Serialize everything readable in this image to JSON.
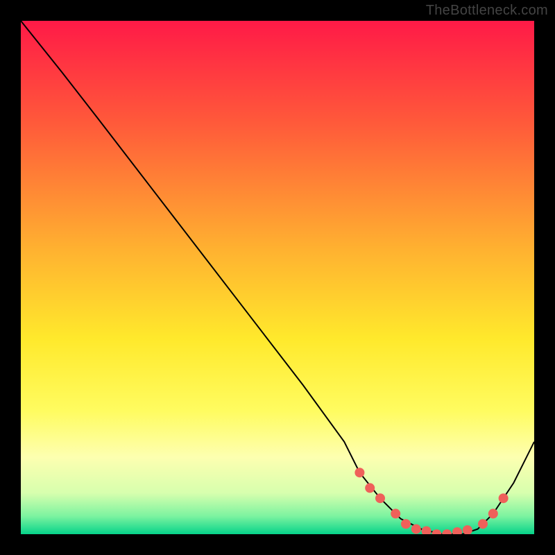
{
  "watermark": "TheBottleneck.com",
  "chart_data": {
    "type": "line",
    "title": "",
    "xlabel": "",
    "ylabel": "",
    "xlim": [
      0,
      100
    ],
    "ylim": [
      0,
      100
    ],
    "background_gradient": {
      "stops": [
        {
          "pos": 0.0,
          "color": "#ff1a47"
        },
        {
          "pos": 0.2,
          "color": "#ff5a3a"
        },
        {
          "pos": 0.45,
          "color": "#ffb330"
        },
        {
          "pos": 0.62,
          "color": "#ffe92c"
        },
        {
          "pos": 0.76,
          "color": "#fffc60"
        },
        {
          "pos": 0.85,
          "color": "#fdffb0"
        },
        {
          "pos": 0.92,
          "color": "#d7ffae"
        },
        {
          "pos": 0.965,
          "color": "#7cf3a0"
        },
        {
          "pos": 1.0,
          "color": "#06d38a"
        }
      ]
    },
    "series": [
      {
        "name": "bottleneck-curve",
        "color": "#000000",
        "x": [
          0,
          4,
          8,
          15,
          25,
          35,
          45,
          55,
          63,
          66,
          70,
          74,
          78,
          82,
          86,
          89,
          92,
          96,
          100
        ],
        "y": [
          100,
          95,
          90,
          81,
          68,
          55,
          42,
          29,
          18,
          12,
          7,
          3,
          1,
          0,
          0,
          1,
          4,
          10,
          18
        ]
      }
    ],
    "markers": {
      "name": "highlight-dots",
      "color": "#ef605a",
      "radius": 7,
      "x": [
        66,
        68,
        70,
        73,
        75,
        77,
        79,
        81,
        83,
        85,
        87,
        90,
        92,
        94
      ],
      "y": [
        12,
        9,
        7,
        4,
        2,
        1,
        0.6,
        0,
        0,
        0.4,
        0.8,
        2,
        4,
        7
      ]
    }
  }
}
